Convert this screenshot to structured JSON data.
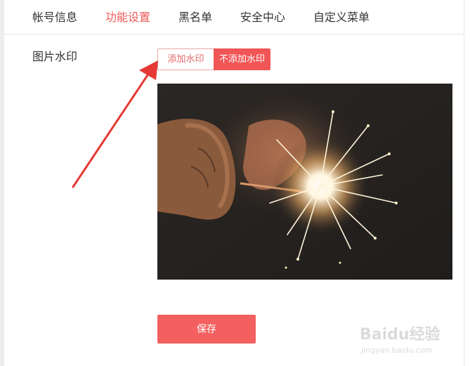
{
  "tabs": [
    {
      "label": "帐号信息",
      "active": false
    },
    {
      "label": "功能设置",
      "active": true
    },
    {
      "label": "黑名单",
      "active": false
    },
    {
      "label": "安全中心",
      "active": false
    },
    {
      "label": "自定义菜单",
      "active": false
    }
  ],
  "setting": {
    "label": "图片水印",
    "option_add": "添加水印",
    "option_none": "不添加水印",
    "selected": "不添加水印"
  },
  "actions": {
    "save_label": "保存"
  },
  "watermark": {
    "brand": "Baidu经验",
    "site": "jingyan.baidu.com"
  },
  "colors": {
    "accent": "#f05656",
    "active_tab": "#ef5a5a",
    "arrow": "#e53935"
  }
}
